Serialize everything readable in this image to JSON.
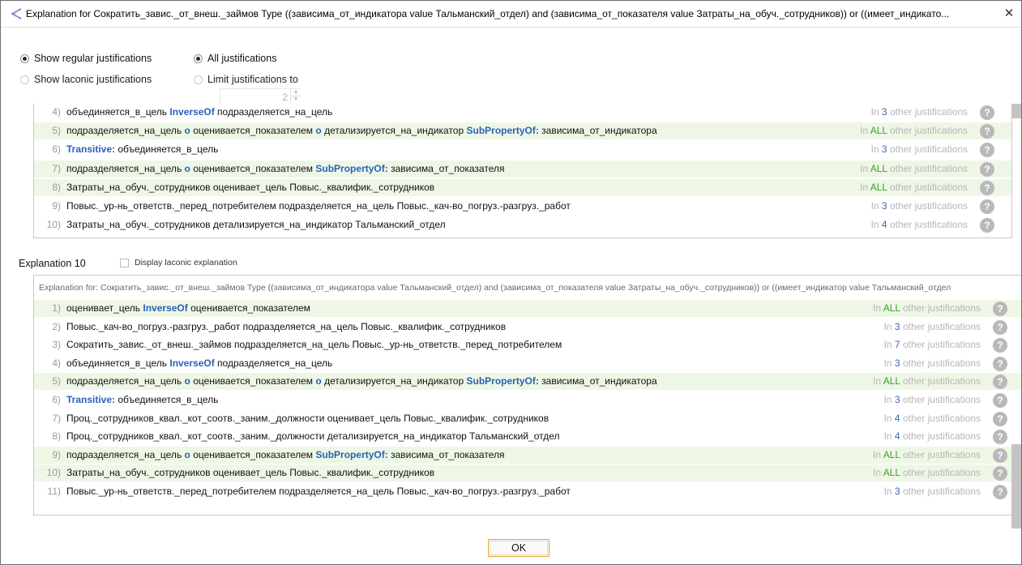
{
  "window": {
    "title": "Explanation for Сократить_завис._от_внеш._займов Type ((зависима_от_индикатора value Тальманский_отдел) and (зависима_от_показателя value Затраты_на_обуч._сотрудников)) or ((имеет_индикато...",
    "close_symbol": "✕"
  },
  "options": {
    "regular": "Show regular justifications",
    "laconic": "Show laconic justifications",
    "all": "All justifications",
    "limit": "Limit justifications to",
    "limit_value": "2"
  },
  "prefix": "In",
  "suffix": "other justifications",
  "help_symbol": "?",
  "colors": {
    "keyword": "#2a61b8",
    "count_blue": "#3e66b0",
    "count_green": "#3c9f2f",
    "row_highlight": "#eef7e6"
  },
  "explanation9": {
    "rows": [
      {
        "n": "4)",
        "pre": "объединяется_в_цель ",
        "kw": "InverseOf",
        "post": " подразделяется_на_цель",
        "count": "3",
        "hl": false
      },
      {
        "n": "5)",
        "pre": "подразделяется_на_цель ",
        "kw": "o",
        "mid": " оценивается_показателем ",
        "kw2": "o",
        "mid2": " детализируется_на_индикатор ",
        "kw3": "SubPropertyOf:",
        "post": " зависима_от_индикатора",
        "count": "ALL",
        "hl": true
      },
      {
        "n": "6)",
        "pre": "",
        "kw": "Transitive:",
        "post": " объединяется_в_цель",
        "count": "3",
        "hl": false
      },
      {
        "n": "7)",
        "pre": "подразделяется_на_цель ",
        "kw": "o",
        "mid": " оценивается_показателем ",
        "kw2": "SubPropertyOf:",
        "post": " зависима_от_показателя",
        "count": "ALL",
        "hl": true
      },
      {
        "n": "8)",
        "pre": "Затраты_на_обуч._сотрудников оценивает_цель Повыс._квалифик._сотрудников",
        "count": "ALL",
        "hl": true
      },
      {
        "n": "9)",
        "pre": "Повыс._ур-нь_ответств._перед_потребителем подразделяется_на_цель Повыс._кач-во_погруз.-разгруз._работ",
        "count": "3",
        "hl": false
      },
      {
        "n": "10)",
        "pre": "Затраты_на_обуч._сотрудников детализируется_на_индикатор Тальманский_отдел",
        "count": "4",
        "hl": false
      }
    ]
  },
  "explanation10": {
    "label": "Explanation 10",
    "laconic_checkbox": "Display laconic explanation",
    "header": "Explanation for: Сократить_завис._от_внеш._займов Type ((зависима_от_индикатора value Тальманский_отдел) and (зависима_от_показателя value Затраты_на_обуч._сотрудников)) or ((имеет_индикатор value Тальманский_отдел",
    "rows": [
      {
        "n": "1)",
        "pre": "оценивает_цель ",
        "kw": "InverseOf",
        "post": " оценивается_показателем",
        "count": "ALL",
        "hl": true
      },
      {
        "n": "2)",
        "pre": "Повыс._кач-во_погруз.-разгруз._работ подразделяется_на_цель Повыс._квалифик._сотрудников",
        "count": "3",
        "hl": false
      },
      {
        "n": "3)",
        "pre": "Сократить_завис._от_внеш._займов подразделяется_на_цель Повыс._ур-нь_ответств._перед_потребителем",
        "count": "7",
        "hl": false
      },
      {
        "n": "4)",
        "pre": "объединяется_в_цель ",
        "kw": "InverseOf",
        "post": " подразделяется_на_цель",
        "count": "3",
        "hl": false
      },
      {
        "n": "5)",
        "pre": "подразделяется_на_цель ",
        "kw": "o",
        "mid": " оценивается_показателем ",
        "kw2": "o",
        "mid2": " детализируется_на_индикатор ",
        "kw3": "SubPropertyOf:",
        "post": " зависима_от_индикатора",
        "count": "ALL",
        "hl": true
      },
      {
        "n": "6)",
        "pre": "",
        "kw": "Transitive:",
        "post": " объединяется_в_цель",
        "count": "3",
        "hl": false
      },
      {
        "n": "7)",
        "pre": "Проц._сотрудников_квал._кот_соотв._заним._должности оценивает_цель Повыс._квалифик._сотрудников",
        "count": "4",
        "hl": false
      },
      {
        "n": "8)",
        "pre": "Проц._сотрудников_квал._кот_соотв._заним._должности детализируется_на_индикатор Тальманский_отдел",
        "count": "4",
        "hl": false
      },
      {
        "n": "9)",
        "pre": "подразделяется_на_цель ",
        "kw": "o",
        "mid": " оценивается_показателем ",
        "kw2": "SubPropertyOf:",
        "post": " зависима_от_показателя",
        "count": "ALL",
        "hl": true
      },
      {
        "n": "10)",
        "pre": "Затраты_на_обуч._сотрудников оценивает_цель Повыс._квалифик._сотрудников",
        "count": "ALL",
        "hl": true
      },
      {
        "n": "11)",
        "pre": "Повыс._ур-нь_ответств._перед_потребителем подразделяется_на_цель Повыс._кач-во_погруз.-разгруз._работ",
        "count": "3",
        "hl": false
      }
    ]
  },
  "ok_label": "OK"
}
